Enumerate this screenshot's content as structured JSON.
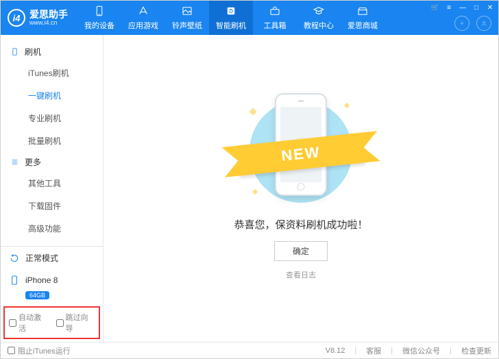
{
  "brand": {
    "name": "爱思助手",
    "site": "www.i4.cn",
    "logo_text": "i4"
  },
  "window_controls": [
    "🛒",
    "≡",
    "—",
    "□",
    "✕"
  ],
  "nav_tabs": [
    {
      "id": "device",
      "label": "我的设备"
    },
    {
      "id": "apps",
      "label": "应用游戏"
    },
    {
      "id": "ringtone",
      "label": "铃声壁纸"
    },
    {
      "id": "flash",
      "label": "智能刷机",
      "active": true
    },
    {
      "id": "toolbox",
      "label": "工具箱"
    },
    {
      "id": "tutorial",
      "label": "教程中心"
    },
    {
      "id": "store",
      "label": "爱思商城"
    }
  ],
  "sidebar": {
    "groups": [
      {
        "title": "刷机",
        "items": [
          "iTunes刷机",
          "一键刷机",
          "专业刷机",
          "批量刷机"
        ],
        "selected": 1
      },
      {
        "title": "更多",
        "items": [
          "其他工具",
          "下载固件",
          "高级功能"
        ],
        "selected": -1
      }
    ],
    "mode": {
      "label": "正常模式"
    },
    "device": {
      "name": "iPhone 8",
      "badge": "64GB"
    },
    "checks": {
      "auto_activate": "自动激活",
      "skip_guide": "跳过向导"
    }
  },
  "main": {
    "ribbon_text": "NEW",
    "message": "恭喜您，保资料刷机成功啦！",
    "ok": "确定",
    "view_log": "查看日志"
  },
  "footer": {
    "block_itunes": "阻止iTunes运行",
    "version": "V8.12",
    "links": [
      "客服",
      "微信公众号",
      "检查更新"
    ]
  }
}
